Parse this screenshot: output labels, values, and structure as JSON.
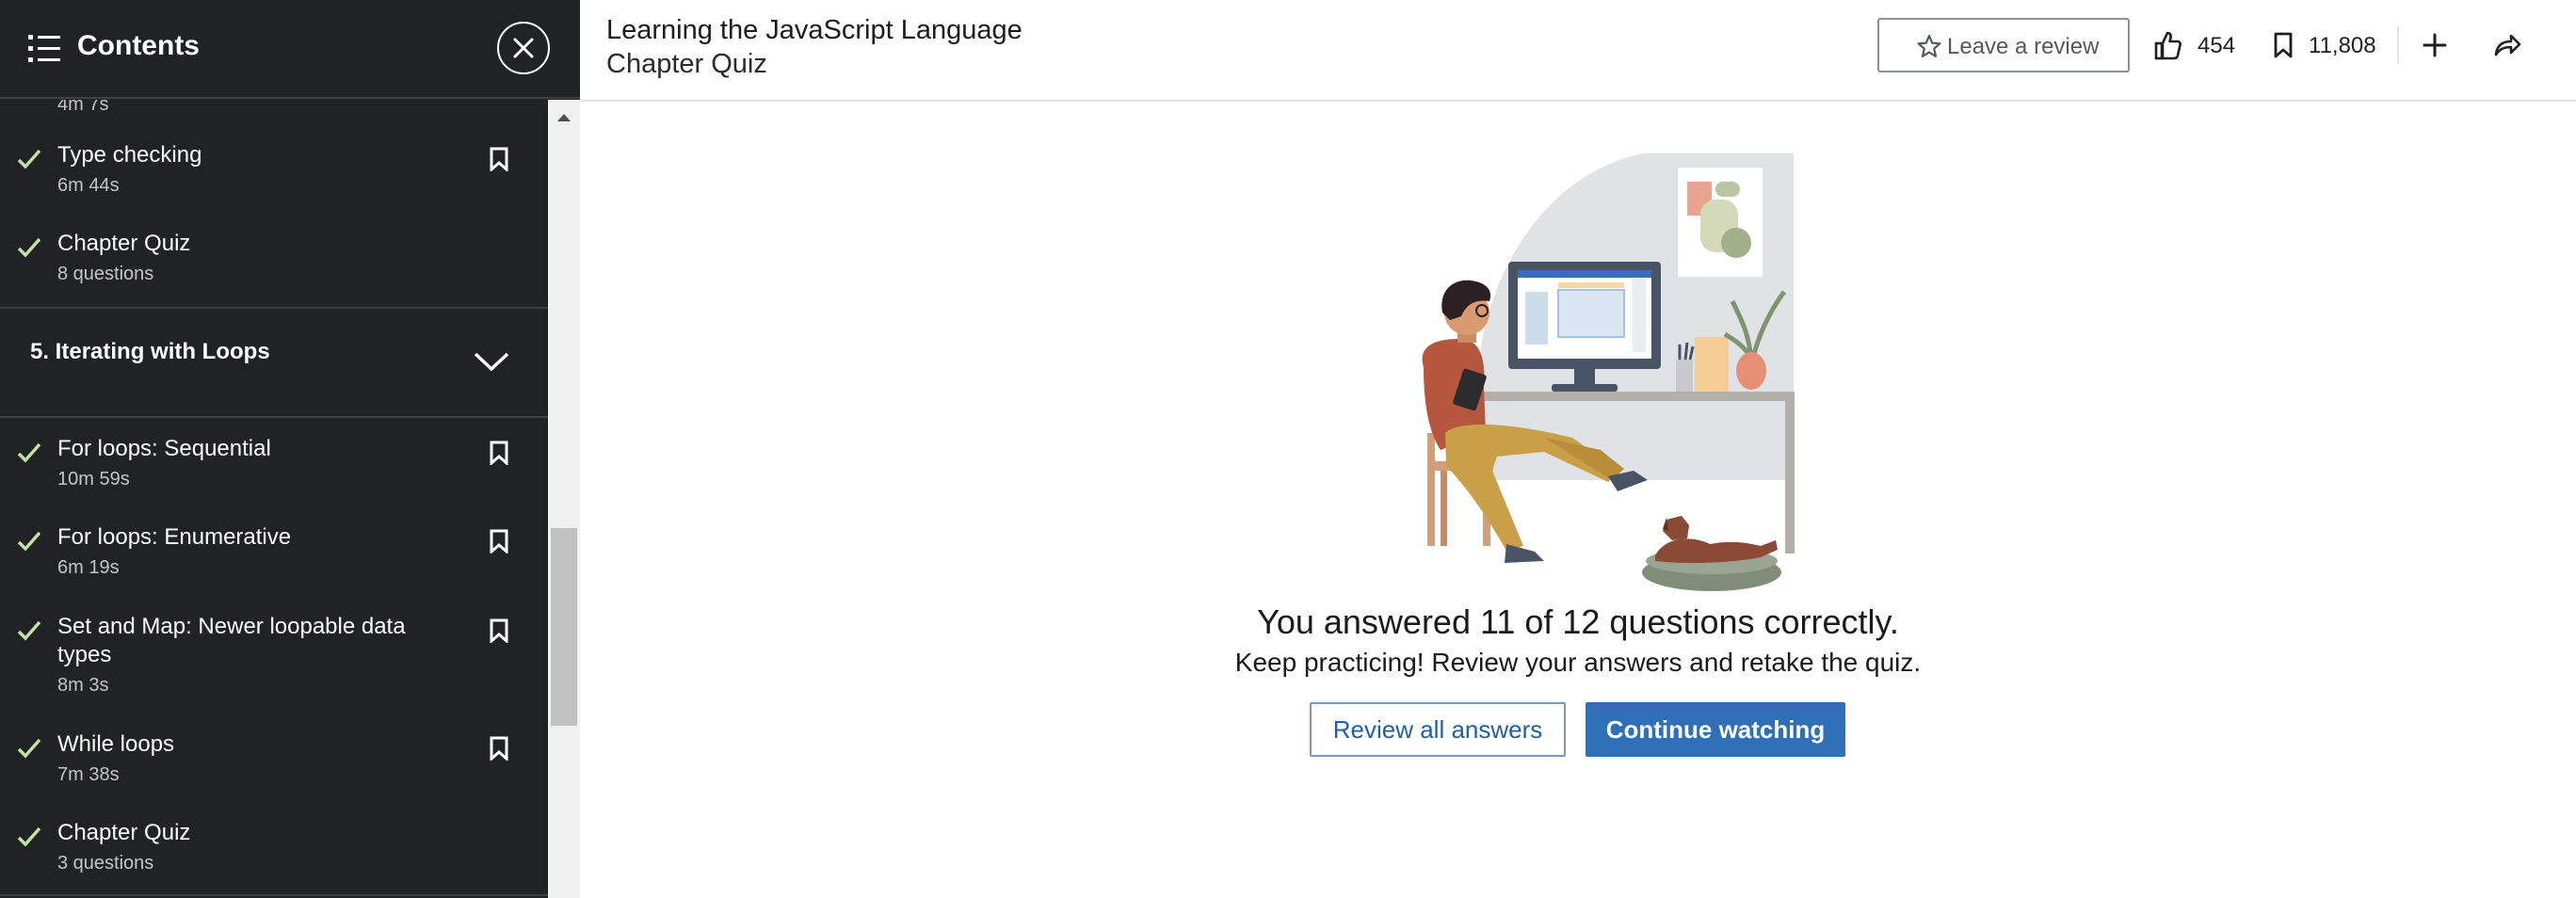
{
  "sidebar": {
    "title": "Contents",
    "partial_meta": "4m 7s",
    "items_before": [
      {
        "title": "Type checking",
        "meta": "6m 44s",
        "bookmark": true
      },
      {
        "title": "Chapter Quiz",
        "meta": "8 questions",
        "bookmark": false
      }
    ],
    "section": {
      "title": "5. Iterating with Loops"
    },
    "items": [
      {
        "title": "For loops: Sequential",
        "meta": "10m 59s",
        "bookmark": true
      },
      {
        "title": "For loops: Enumerative",
        "meta": "6m 19s",
        "bookmark": true
      },
      {
        "title": "Set and Map: Newer loopable data types",
        "meta": "8m 3s",
        "bookmark": true
      },
      {
        "title": "While loops",
        "meta": "7m 38s",
        "bookmark": true
      },
      {
        "title": "Chapter Quiz",
        "meta": "3 questions",
        "bookmark": false
      }
    ]
  },
  "header": {
    "course_title": "Learning the JavaScript Language",
    "subtitle": "Chapter Quiz",
    "review_label": "Leave a review",
    "likes": "454",
    "saves": "11,808"
  },
  "main": {
    "result": "You answered 11 of 12 questions correctly.",
    "advice": "Keep practicing! Review your answers and retake the quiz.",
    "review_button": "Review all answers",
    "continue_button": "Continue watching"
  },
  "colors": {
    "sidebar_bg": "#1f2324",
    "check": "#c5e0a5",
    "primary_button": "#2e6fb5"
  }
}
